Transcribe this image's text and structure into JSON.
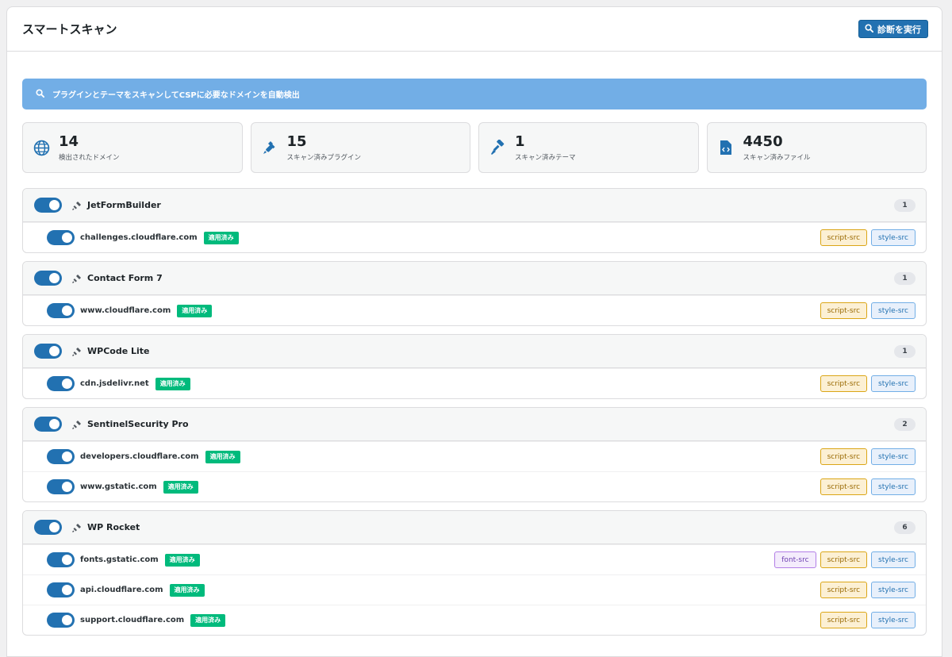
{
  "header": {
    "title": "スマートスキャン",
    "run_button": "診断を実行"
  },
  "banner": {
    "text": "プラグインとテーマをスキャンしてCSPに必要なドメインを自動検出"
  },
  "stats": [
    {
      "value": "14",
      "label": "検出されたドメイン",
      "icon": "globe-icon"
    },
    {
      "value": "15",
      "label": "スキャン済みプラグイン",
      "icon": "plugin-icon"
    },
    {
      "value": "1",
      "label": "スキャン済みテーマ",
      "icon": "brush-icon"
    },
    {
      "value": "4450",
      "label": "スキャン済みファイル",
      "icon": "code-file-icon"
    }
  ],
  "applied_label": "適用済み",
  "groups": [
    {
      "name": "JetFormBuilder",
      "count": "1",
      "domains": [
        {
          "domain": "challenges.cloudflare.com",
          "directives": [
            "script-src",
            "style-src"
          ]
        }
      ]
    },
    {
      "name": "Contact Form 7",
      "count": "1",
      "domains": [
        {
          "domain": "www.cloudflare.com",
          "directives": [
            "script-src",
            "style-src"
          ]
        }
      ]
    },
    {
      "name": "WPCode Lite",
      "count": "1",
      "domains": [
        {
          "domain": "cdn.jsdelivr.net",
          "directives": [
            "script-src",
            "style-src"
          ]
        }
      ]
    },
    {
      "name": "SentinelSecurity Pro",
      "count": "2",
      "domains": [
        {
          "domain": "developers.cloudflare.com",
          "directives": [
            "script-src",
            "style-src"
          ]
        },
        {
          "domain": "www.gstatic.com",
          "directives": [
            "script-src",
            "style-src"
          ]
        }
      ]
    },
    {
      "name": "WP Rocket",
      "count": "6",
      "domains": [
        {
          "domain": "fonts.gstatic.com",
          "directives": [
            "font-src",
            "script-src",
            "style-src"
          ]
        },
        {
          "domain": "api.cloudflare.com",
          "directives": [
            "script-src",
            "style-src"
          ]
        },
        {
          "domain": "support.cloudflare.com",
          "directives": [
            "script-src",
            "style-src"
          ]
        }
      ]
    }
  ]
}
